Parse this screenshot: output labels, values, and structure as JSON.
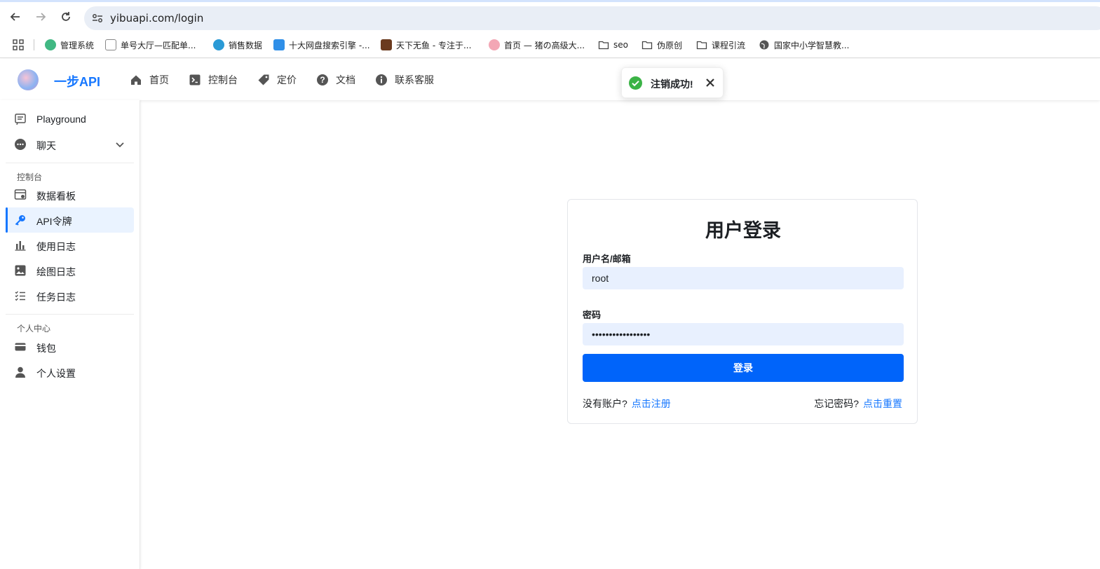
{
  "browser": {
    "url": "yibuapi.com/login",
    "bookmarks": [
      {
        "label": "管理系统",
        "icon": "vue-icon",
        "color": "#41b883"
      },
      {
        "label": "单号大厅—匹配单...",
        "icon": "page-icon",
        "color": "#888888"
      },
      {
        "label": "销售数据",
        "icon": "shield-icon",
        "color": "#2a9ad6"
      },
      {
        "label": "十大网盘搜索引擎 -...",
        "icon": "ling-icon",
        "color": "#2f8fe8"
      },
      {
        "label": "天下无鱼 - 专注于...",
        "icon": "image-icon",
        "color": "#6a3a1e"
      },
      {
        "label": "首页 — 猪の高级大...",
        "icon": "pig-icon",
        "color": "#f3a7b5"
      },
      {
        "label": "seo",
        "icon": "folder-icon",
        "color": "#444444"
      },
      {
        "label": "伪原创",
        "icon": "folder-icon",
        "color": "#444444"
      },
      {
        "label": "课程引流",
        "icon": "folder-icon",
        "color": "#444444"
      },
      {
        "label": "国家中小学智慧教...",
        "icon": "globe-icon",
        "color": "#444444"
      }
    ]
  },
  "header": {
    "brand": "一步API",
    "nav": [
      {
        "label": "首页",
        "icon": "home-icon"
      },
      {
        "label": "控制台",
        "icon": "terminal-icon"
      },
      {
        "label": "定价",
        "icon": "tag-icon"
      },
      {
        "label": "文档",
        "icon": "help-icon"
      },
      {
        "label": "联系客服",
        "icon": "info-icon"
      }
    ]
  },
  "toast": {
    "message": "注销成功!"
  },
  "sidebar": {
    "top_items": [
      {
        "label": "Playground",
        "icon": "playground-icon"
      },
      {
        "label": "聊天",
        "icon": "chat-icon"
      }
    ],
    "section_console": "控制台",
    "console_items": [
      {
        "label": "数据看板",
        "icon": "dashboard-icon",
        "active": false
      },
      {
        "label": "API令牌",
        "icon": "key-icon",
        "active": true
      },
      {
        "label": "使用日志",
        "icon": "bar-chart-icon",
        "active": false
      },
      {
        "label": "绘图日志",
        "icon": "image-icon",
        "active": false
      },
      {
        "label": "任务日志",
        "icon": "task-list-icon",
        "active": false
      }
    ],
    "section_personal": "个人中心",
    "personal_items": [
      {
        "label": "钱包",
        "icon": "wallet-icon"
      },
      {
        "label": "个人设置",
        "icon": "user-icon"
      }
    ]
  },
  "login": {
    "title": "用户登录",
    "username_label": "用户名/邮箱",
    "username_value": "root",
    "password_label": "密码",
    "password_value": "•••••••••••••••••",
    "submit_label": "登录",
    "no_account_text": "没有账户?",
    "register_link": "点击注册",
    "forgot_text": "忘记密码?",
    "reset_link": "点击重置"
  },
  "colors": {
    "accent": "#1677ff",
    "button": "#0064fa",
    "success": "#3bb346"
  }
}
